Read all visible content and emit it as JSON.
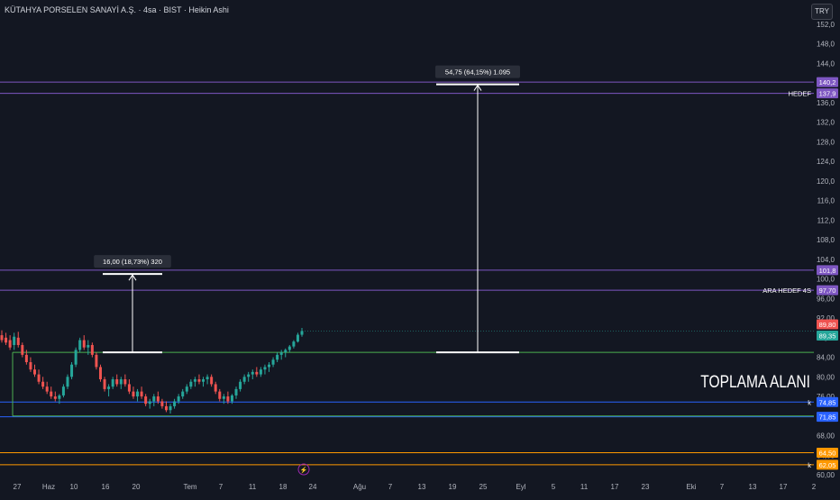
{
  "header": {
    "title": "KÜTAHYA PORSELEN SANAYİ A.Ş. · 4sa · BIST · Heikin Ashi",
    "currency": "TRY"
  },
  "colors": {
    "background": "#131722",
    "up": "#26a69a",
    "down": "#ef5350",
    "purple_line": "#7e57c2",
    "green_line": "#4caf50",
    "blue_line": "#2962ff",
    "orange_line": "#ff9800",
    "axis_text": "#b2b5be",
    "white": "#ffffff"
  },
  "chart_data": {
    "type": "candlestick",
    "style": "Heikin Ashi",
    "y_axis": {
      "min": 60,
      "max": 152,
      "ticks": [
        60,
        64,
        68,
        72,
        76,
        80,
        84,
        88,
        92,
        96,
        100,
        104,
        108,
        112,
        116,
        120,
        124,
        128,
        132,
        136,
        140,
        144,
        148,
        152
      ],
      "tick_labels": [
        "60,00",
        "64,00",
        "68,00",
        "72,00",
        "76,00",
        "80,00",
        "84,00",
        "88,00",
        "92,00",
        "96,00",
        "100,0",
        "104,0",
        "108,0",
        "112,0",
        "116,0",
        "120,0",
        "124,0",
        "128,0",
        "132,0",
        "136,0",
        "140,0",
        "144,0",
        "148,0",
        "152,0"
      ],
      "grid": false
    },
    "x_axis": {
      "tick_labels": [
        "27",
        "Haz",
        "10",
        "16",
        "20",
        "Tem",
        "7",
        "11",
        "18",
        "24",
        "Ağu",
        "7",
        "13",
        "19",
        "25",
        "Eyl",
        "5",
        "11",
        "17",
        "23",
        "Eki",
        "7",
        "13",
        "17",
        "2"
      ]
    },
    "candles": [
      {
        "o": 88.5,
        "h": 89.5,
        "l": 87.0,
        "c": 87.5
      },
      {
        "o": 88.0,
        "h": 89.0,
        "l": 86.5,
        "c": 87.0
      },
      {
        "o": 87.5,
        "h": 88.5,
        "l": 85.5,
        "c": 86.0
      },
      {
        "o": 86.5,
        "h": 89.0,
        "l": 85.5,
        "c": 88.2
      },
      {
        "o": 88.0,
        "h": 89.2,
        "l": 86.0,
        "c": 86.5
      },
      {
        "o": 86.5,
        "h": 87.0,
        "l": 84.0,
        "c": 84.5
      },
      {
        "o": 84.5,
        "h": 85.5,
        "l": 82.5,
        "c": 83.0
      },
      {
        "o": 83.0,
        "h": 84.0,
        "l": 81.0,
        "c": 81.5
      },
      {
        "o": 81.5,
        "h": 82.5,
        "l": 80.0,
        "c": 80.5
      },
      {
        "o": 80.5,
        "h": 81.5,
        "l": 78.5,
        "c": 79.0
      },
      {
        "o": 79.0,
        "h": 80.0,
        "l": 77.5,
        "c": 78.0
      },
      {
        "o": 78.0,
        "h": 79.0,
        "l": 76.5,
        "c": 77.0
      },
      {
        "o": 77.0,
        "h": 78.0,
        "l": 75.5,
        "c": 76.0
      },
      {
        "o": 76.0,
        "h": 77.0,
        "l": 75.0,
        "c": 75.5
      },
      {
        "o": 75.5,
        "h": 76.5,
        "l": 74.5,
        "c": 76.2
      },
      {
        "o": 76.2,
        "h": 78.5,
        "l": 75.8,
        "c": 78.0
      },
      {
        "o": 78.0,
        "h": 80.5,
        "l": 77.5,
        "c": 80.0
      },
      {
        "o": 80.0,
        "h": 83.0,
        "l": 79.5,
        "c": 82.5
      },
      {
        "o": 82.5,
        "h": 86.0,
        "l": 82.0,
        "c": 85.5
      },
      {
        "o": 85.5,
        "h": 88.0,
        "l": 85.0,
        "c": 87.5
      },
      {
        "o": 87.5,
        "h": 88.5,
        "l": 85.5,
        "c": 86.0
      },
      {
        "o": 86.0,
        "h": 87.5,
        "l": 84.5,
        "c": 86.5
      },
      {
        "o": 86.5,
        "h": 87.0,
        "l": 84.0,
        "c": 84.5
      },
      {
        "o": 84.5,
        "h": 85.0,
        "l": 81.5,
        "c": 82.0
      },
      {
        "o": 82.0,
        "h": 82.5,
        "l": 79.0,
        "c": 79.5
      },
      {
        "o": 79.5,
        "h": 80.0,
        "l": 77.0,
        "c": 77.5
      },
      {
        "o": 77.5,
        "h": 78.5,
        "l": 76.0,
        "c": 78.0
      },
      {
        "o": 78.0,
        "h": 80.0,
        "l": 77.5,
        "c": 79.5
      },
      {
        "o": 79.5,
        "h": 80.5,
        "l": 78.0,
        "c": 78.5
      },
      {
        "o": 78.5,
        "h": 80.0,
        "l": 77.5,
        "c": 79.5
      },
      {
        "o": 79.5,
        "h": 80.5,
        "l": 78.0,
        "c": 78.5
      },
      {
        "o": 78.5,
        "h": 79.5,
        "l": 76.5,
        "c": 77.0
      },
      {
        "o": 77.0,
        "h": 78.0,
        "l": 75.5,
        "c": 76.0
      },
      {
        "o": 76.0,
        "h": 77.5,
        "l": 75.0,
        "c": 77.0
      },
      {
        "o": 77.0,
        "h": 78.0,
        "l": 75.5,
        "c": 76.0
      },
      {
        "o": 76.0,
        "h": 76.5,
        "l": 74.0,
        "c": 74.5
      },
      {
        "o": 74.5,
        "h": 75.5,
        "l": 73.5,
        "c": 75.0
      },
      {
        "o": 75.0,
        "h": 76.5,
        "l": 74.0,
        "c": 76.0
      },
      {
        "o": 76.0,
        "h": 77.0,
        "l": 74.5,
        "c": 75.0
      },
      {
        "o": 75.0,
        "h": 75.5,
        "l": 73.5,
        "c": 74.0
      },
      {
        "o": 74.0,
        "h": 75.0,
        "l": 72.8,
        "c": 73.2
      },
      {
        "o": 73.2,
        "h": 74.5,
        "l": 72.5,
        "c": 74.0
      },
      {
        "o": 74.0,
        "h": 75.5,
        "l": 73.5,
        "c": 75.0
      },
      {
        "o": 75.0,
        "h": 76.5,
        "l": 74.5,
        "c": 76.0
      },
      {
        "o": 76.0,
        "h": 77.5,
        "l": 75.5,
        "c": 77.0
      },
      {
        "o": 77.0,
        "h": 78.5,
        "l": 76.5,
        "c": 78.0
      },
      {
        "o": 78.0,
        "h": 79.5,
        "l": 77.5,
        "c": 79.0
      },
      {
        "o": 79.0,
        "h": 80.0,
        "l": 78.0,
        "c": 79.5
      },
      {
        "o": 79.5,
        "h": 80.5,
        "l": 78.5,
        "c": 79.0
      },
      {
        "o": 79.0,
        "h": 80.0,
        "l": 78.0,
        "c": 79.5
      },
      {
        "o": 79.5,
        "h": 80.5,
        "l": 78.5,
        "c": 80.0
      },
      {
        "o": 80.0,
        "h": 80.5,
        "l": 78.0,
        "c": 78.5
      },
      {
        "o": 78.5,
        "h": 79.0,
        "l": 76.5,
        "c": 77.0
      },
      {
        "o": 77.0,
        "h": 77.5,
        "l": 75.0,
        "c": 75.5
      },
      {
        "o": 75.5,
        "h": 76.5,
        "l": 74.5,
        "c": 76.0
      },
      {
        "o": 76.0,
        "h": 77.0,
        "l": 74.5,
        "c": 75.0
      },
      {
        "o": 75.0,
        "h": 76.5,
        "l": 74.5,
        "c": 76.2
      },
      {
        "o": 76.2,
        "h": 78.0,
        "l": 75.5,
        "c": 77.5
      },
      {
        "o": 77.5,
        "h": 79.5,
        "l": 77.0,
        "c": 79.0
      },
      {
        "o": 79.0,
        "h": 80.5,
        "l": 78.5,
        "c": 80.0
      },
      {
        "o": 80.0,
        "h": 81.0,
        "l": 79.0,
        "c": 80.5
      },
      {
        "o": 80.5,
        "h": 81.5,
        "l": 79.5,
        "c": 81.0
      },
      {
        "o": 81.0,
        "h": 82.0,
        "l": 80.0,
        "c": 80.5
      },
      {
        "o": 80.5,
        "h": 82.0,
        "l": 80.0,
        "c": 81.5
      },
      {
        "o": 81.5,
        "h": 82.5,
        "l": 80.5,
        "c": 82.0
      },
      {
        "o": 82.0,
        "h": 83.0,
        "l": 81.0,
        "c": 82.5
      },
      {
        "o": 82.5,
        "h": 84.0,
        "l": 82.0,
        "c": 83.5
      },
      {
        "o": 83.5,
        "h": 85.0,
        "l": 83.0,
        "c": 84.5
      },
      {
        "o": 84.5,
        "h": 85.5,
        "l": 83.5,
        "c": 85.0
      },
      {
        "o": 85.0,
        "h": 85.8,
        "l": 84.0,
        "c": 85.5
      },
      {
        "o": 85.5,
        "h": 86.5,
        "l": 85.0,
        "c": 86.2
      },
      {
        "o": 86.2,
        "h": 87.5,
        "l": 85.8,
        "c": 87.2
      },
      {
        "o": 87.2,
        "h": 89.0,
        "l": 87.0,
        "c": 88.6
      },
      {
        "o": 88.6,
        "h": 90.0,
        "l": 88.2,
        "c": 89.35
      }
    ],
    "levels": [
      {
        "name": "hedef-line",
        "value": 140.2,
        "label": "140,2",
        "color": "#7e57c2"
      },
      {
        "name": "hedef-line-2",
        "value": 137.9,
        "label": "137,9",
        "color": "#7e57c2",
        "text": "HEDEF"
      },
      {
        "name": "ara-hedef-line-1",
        "value": 101.8,
        "label": "101,8",
        "color": "#7e57c2"
      },
      {
        "name": "ara-hedef-line-2",
        "value": 97.7,
        "label": "97,70",
        "color": "#7e57c2",
        "text": "ARA HEDEF  4S"
      },
      {
        "name": "toplama-top-line",
        "value": 85.0,
        "color": "#4caf50"
      },
      {
        "name": "blue-line-1",
        "value": 74.85,
        "label": "74,85",
        "color": "#2962ff",
        "text": "k"
      },
      {
        "name": "blue-line-2",
        "value": 71.85,
        "label": "71,85",
        "color": "#2962ff"
      },
      {
        "name": "orange-line-1",
        "value": 64.5,
        "label": "64,50",
        "color": "#ff9800"
      },
      {
        "name": "orange-line-2",
        "value": 62.05,
        "label": "62,05",
        "color": "#ff9800",
        "text": "k"
      }
    ],
    "price_labels": [
      {
        "value": 89.8,
        "label": "89,80",
        "color": "#ef5350"
      },
      {
        "value": 89.35,
        "label": "89,35",
        "color": "#26a69a"
      }
    ],
    "measurements": [
      {
        "name": "measure-small",
        "from": 85.0,
        "to": 101.0,
        "label": "16,00 (18,73%) 320"
      },
      {
        "name": "measure-large",
        "from": 85.0,
        "to": 139.75,
        "label": "54,75 (64,15%) 1.095"
      }
    ],
    "zone": {
      "name": "toplama-alani",
      "label": "TOPLAMA ALANI",
      "top": 85.0,
      "bottom": 72.0
    }
  }
}
